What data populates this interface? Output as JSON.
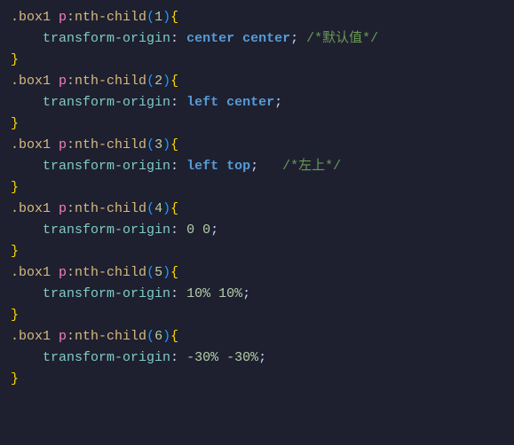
{
  "rules": [
    {
      "selector": {
        "class": ".box1",
        "tag": "p",
        "pseudo": ":nth-child",
        "arg": "1"
      },
      "property": "transform-origin",
      "values": [
        {
          "text": "center",
          "kind": "keyword"
        },
        {
          "text": "center",
          "kind": "keyword"
        }
      ],
      "comment": "/*默认值*/",
      "gap": " "
    },
    {
      "selector": {
        "class": ".box1",
        "tag": "p",
        "pseudo": ":nth-child",
        "arg": "2"
      },
      "property": "transform-origin",
      "values": [
        {
          "text": "left",
          "kind": "keyword"
        },
        {
          "text": "center",
          "kind": "keyword"
        }
      ],
      "comment": null
    },
    {
      "selector": {
        "class": ".box1",
        "tag": "p",
        "pseudo": ":nth-child",
        "arg": "3"
      },
      "property": "transform-origin",
      "values": [
        {
          "text": "left",
          "kind": "keyword"
        },
        {
          "text": "top",
          "kind": "keyword"
        }
      ],
      "comment": "/*左上*/",
      "gap": "   "
    },
    {
      "selector": {
        "class": ".box1",
        "tag": "p",
        "pseudo": ":nth-child",
        "arg": "4"
      },
      "property": "transform-origin",
      "values": [
        {
          "text": "0",
          "kind": "number"
        },
        {
          "text": "0",
          "kind": "number"
        }
      ],
      "comment": null
    },
    {
      "selector": {
        "class": ".box1",
        "tag": "p",
        "pseudo": ":nth-child",
        "arg": "5"
      },
      "property": "transform-origin",
      "values": [
        {
          "text": "10%",
          "kind": "percent"
        },
        {
          "text": "10%",
          "kind": "percent"
        }
      ],
      "comment": null
    },
    {
      "selector": {
        "class": ".box1",
        "tag": "p",
        "pseudo": ":nth-child",
        "arg": "6"
      },
      "property": "transform-origin",
      "values": [
        {
          "text": "-30%",
          "kind": "percent"
        },
        {
          "text": "-30%",
          "kind": "percent"
        }
      ],
      "comment": null
    }
  ]
}
